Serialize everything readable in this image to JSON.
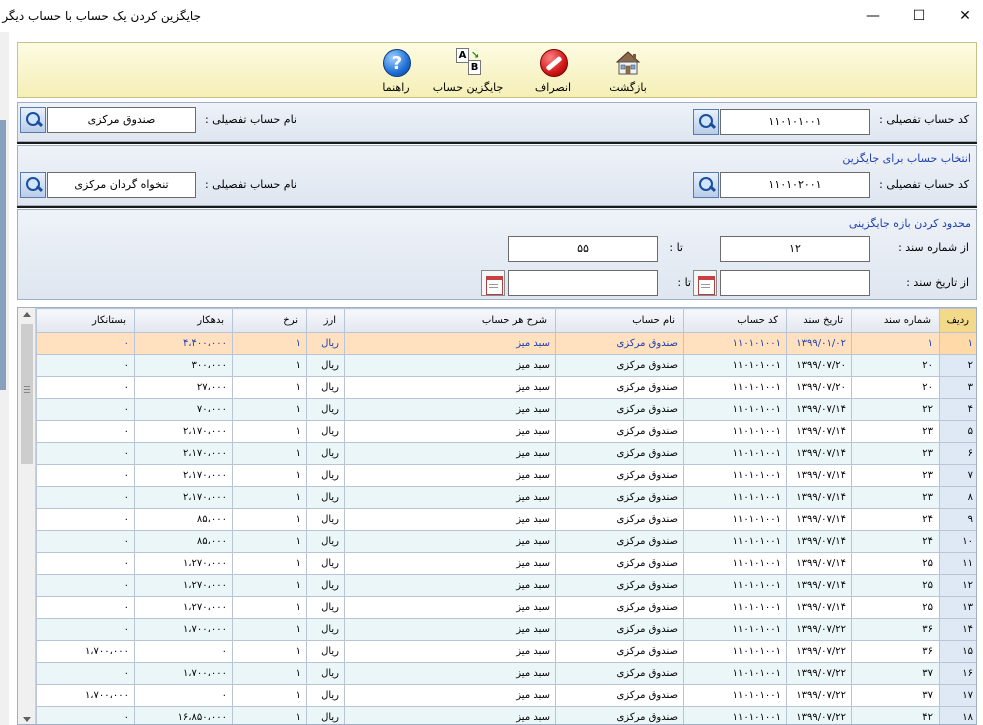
{
  "window": {
    "title": "جایگزین کردن یک حساب با حساب دیگر",
    "minimize_glyph": "—",
    "maximize_glyph": "☐",
    "close_glyph": "✕"
  },
  "toolbar": {
    "back_label": "بازگشت",
    "cancel_label": "انصراف",
    "replace_label": "جایگزین حساب",
    "help_label": "راهنما",
    "help_glyph": "?",
    "ab_a": "A",
    "ab_b": "B"
  },
  "source": {
    "code_label": "کد حساب تفصیلی :",
    "code_value": "۱۱۰۱۰۱۰۰۱",
    "name_label": "نام حساب تفصیلی :",
    "name_value": "صندوق مرکزی"
  },
  "target": {
    "section_title": "انتخاب حساب برای جایگزین",
    "code_label": "کد حساب تفصیلی :",
    "code_value": "۱۱۰۱۰۲۰۰۱",
    "name_label": "نام حساب تفصیلی :",
    "name_value": "تنخواه گردان مرکزی"
  },
  "range": {
    "section_title": "محدود کردن بازه جایگزینی",
    "from_doc_label": "از شماره سند :",
    "from_doc_value": "۱۲",
    "to_label": "تا :",
    "to_doc_value": "۵۵",
    "from_date_label": "از تاریخ سند :",
    "from_date_value": "",
    "to_date_label": "تا :",
    "to_date_value": ""
  },
  "grid": {
    "columns": [
      "ردیف",
      "شماره سند",
      "تاریخ سند",
      "کد حساب",
      "نام حساب",
      "شرح هر حساب",
      "ارز",
      "نرخ",
      "بدهکار",
      "بستانکار"
    ],
    "rows": [
      [
        "۱",
        "۱",
        "۱۳۹۹/۰۱/۰۲",
        "۱۱۰۱۰۱۰۰۱",
        "صندوق مرکزی",
        "سبد میز",
        "ریال",
        "۱",
        "۴،۴۰۰،۰۰۰",
        "۰"
      ],
      [
        "۲",
        "۲۰",
        "۱۳۹۹/۰۷/۲۰",
        "۱۱۰۱۰۱۰۰۱",
        "صندوق مرکزی",
        "سبد میز",
        "ریال",
        "۱",
        "۳۰۰،۰۰۰",
        "۰"
      ],
      [
        "۳",
        "۲۰",
        "۱۳۹۹/۰۷/۲۰",
        "۱۱۰۱۰۱۰۰۱",
        "صندوق مرکزی",
        "سبد میز",
        "ریال",
        "۱",
        "۲۷،۰۰۰",
        "۰"
      ],
      [
        "۴",
        "۲۲",
        "۱۳۹۹/۰۷/۱۴",
        "۱۱۰۱۰۱۰۰۱",
        "صندوق مرکزی",
        "سبد میز",
        "ریال",
        "۱",
        "۷۰،۰۰۰",
        "۰"
      ],
      [
        "۵",
        "۲۳",
        "۱۳۹۹/۰۷/۱۴",
        "۱۱۰۱۰۱۰۰۱",
        "صندوق مرکزی",
        "سبد میز",
        "ریال",
        "۱",
        "۲،۱۷۰،۰۰۰",
        "۰"
      ],
      [
        "۶",
        "۲۳",
        "۱۳۹۹/۰۷/۱۴",
        "۱۱۰۱۰۱۰۰۱",
        "صندوق مرکزی",
        "سبد میز",
        "ریال",
        "۱",
        "۲،۱۷۰،۰۰۰",
        "۰"
      ],
      [
        "۷",
        "۲۳",
        "۱۳۹۹/۰۷/۱۴",
        "۱۱۰۱۰۱۰۰۱",
        "صندوق مرکزی",
        "سبد میز",
        "ریال",
        "۱",
        "۲،۱۷۰،۰۰۰",
        "۰"
      ],
      [
        "۸",
        "۲۳",
        "۱۳۹۹/۰۷/۱۴",
        "۱۱۰۱۰۱۰۰۱",
        "صندوق مرکزی",
        "سبد میز",
        "ریال",
        "۱",
        "۲،۱۷۰،۰۰۰",
        "۰"
      ],
      [
        "۹",
        "۲۴",
        "۱۳۹۹/۰۷/۱۴",
        "۱۱۰۱۰۱۰۰۱",
        "صندوق مرکزی",
        "سبد میز",
        "ریال",
        "۱",
        "۸۵،۰۰۰",
        "۰"
      ],
      [
        "۱۰",
        "۲۴",
        "۱۳۹۹/۰۷/۱۴",
        "۱۱۰۱۰۱۰۰۱",
        "صندوق مرکزی",
        "سبد میز",
        "ریال",
        "۱",
        "۸۵،۰۰۰",
        "۰"
      ],
      [
        "۱۱",
        "۲۵",
        "۱۳۹۹/۰۷/۱۴",
        "۱۱۰۱۰۱۰۰۱",
        "صندوق مرکزی",
        "سبد میز",
        "ریال",
        "۱",
        "۱،۲۷۰،۰۰۰",
        "۰"
      ],
      [
        "۱۲",
        "۲۵",
        "۱۳۹۹/۰۷/۱۴",
        "۱۱۰۱۰۱۰۰۱",
        "صندوق مرکزی",
        "سبد میز",
        "ریال",
        "۱",
        "۱،۲۷۰،۰۰۰",
        "۰"
      ],
      [
        "۱۳",
        "۲۵",
        "۱۳۹۹/۰۷/۱۴",
        "۱۱۰۱۰۱۰۰۱",
        "صندوق مرکزی",
        "سبد میز",
        "ریال",
        "۱",
        "۱،۲۷۰،۰۰۰",
        "۰"
      ],
      [
        "۱۴",
        "۳۶",
        "۱۳۹۹/۰۷/۲۲",
        "۱۱۰۱۰۱۰۰۱",
        "صندوق مرکزی",
        "سبد میز",
        "ریال",
        "۱",
        "۱،۷۰۰،۰۰۰",
        "۰"
      ],
      [
        "۱۵",
        "۳۶",
        "۱۳۹۹/۰۷/۲۲",
        "۱۱۰۱۰۱۰۰۱",
        "صندوق مرکزی",
        "سبد میز",
        "ریال",
        "۱",
        "۰",
        "۱،۷۰۰،۰۰۰"
      ],
      [
        "۱۶",
        "۳۷",
        "۱۳۹۹/۰۷/۲۲",
        "۱۱۰۱۰۱۰۰۱",
        "صندوق مرکزی",
        "سبد میز",
        "ریال",
        "۱",
        "۱،۷۰۰،۰۰۰",
        "۰"
      ],
      [
        "۱۷",
        "۳۷",
        "۱۳۹۹/۰۷/۲۲",
        "۱۱۰۱۰۱۰۰۱",
        "صندوق مرکزی",
        "سبد میز",
        "ریال",
        "۱",
        "۰",
        "۱،۷۰۰،۰۰۰"
      ],
      [
        "۱۸",
        "۴۲",
        "۱۳۹۹/۰۷/۲۲",
        "۱۱۰۱۰۱۰۰۱",
        "صندوق مرکزی",
        "سبد میز",
        "ریال",
        "۱",
        "۱۶،۸۵۰،۰۰۰",
        "۰"
      ]
    ]
  }
}
